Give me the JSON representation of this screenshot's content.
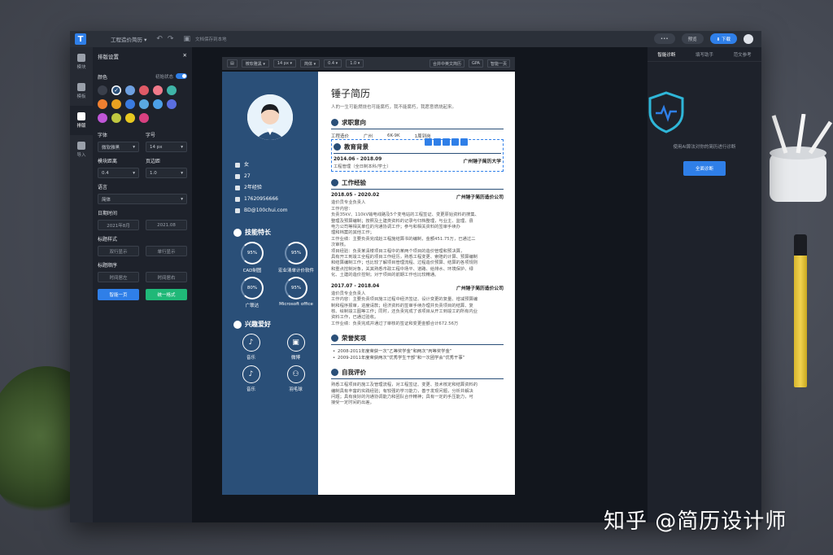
{
  "topbar": {
    "title": "工程造价简历 ▾",
    "save_note": "文档保存到本地",
    "more": "•••",
    "preview": "预览",
    "download": "⬇ 下载"
  },
  "rail": [
    "模块",
    "模板",
    "排版",
    "导入"
  ],
  "settings": {
    "title": "排版设置",
    "color_label": "颜色",
    "initial_state": "初始状态",
    "colors": [
      "#3a3f4b",
      "#2a4f78",
      "#6ea0e0",
      "#e05a66",
      "#f07a8a",
      "#3fb4a8",
      "#f08030",
      "#e8a020",
      "#3a7be0",
      "#5aa8e0",
      "#4ca0e8",
      "#5a6ee0",
      "#c056d8",
      "#c0c840",
      "#e8c820",
      "#d84080"
    ],
    "font_label": "字体",
    "font_value": "微软雅黑",
    "size_label": "字号",
    "size_value": "14 px",
    "module_gap_label": "模块距离",
    "module_gap_value": "0.4",
    "page_margin_label": "页边距",
    "page_margin_value": "1.0",
    "lang_label": "语言",
    "lang_value": "简体",
    "date_label": "日期时间",
    "date_a": "2021年8月",
    "date_b": "2021.08",
    "title_style_label": "标题样式",
    "style_a": "双行显示",
    "style_b": "单行显示",
    "title_order_label": "标题顺序",
    "order_a": "时间居左",
    "order_b": "时间居右",
    "btn_one_page": "智能一页",
    "btn_unify": "统一格式"
  },
  "toolbar2": {
    "font": "微软雅黑 ▾",
    "size": "14 px ▾",
    "lang": "简体 ▾",
    "gap": "0.4 ▾",
    "margin": "1.0 ▾",
    "btn_merge": "合并中英文简历",
    "btn_gpa": "GPA",
    "btn_one_page": "智能一页"
  },
  "resume": {
    "name": "锤子简历",
    "motto": "人的一生可能燃烧也可能腐朽，我不能腐朽，我愿意燃烧起来。",
    "side": {
      "gender": "女",
      "age": "27",
      "years": "2年经验",
      "phone": "17620956666",
      "email": "BD@100chui.com",
      "skills_title": "技能特长",
      "skills": [
        {
          "pct": "95%",
          "name": "CAD制图"
        },
        {
          "pct": "95%",
          "name": "宏业清单计价软件"
        },
        {
          "pct": "80%",
          "name": "广联达"
        },
        {
          "pct": "95%",
          "name": "Microsoft office"
        }
      ],
      "hobby_title": "兴趣爱好",
      "hobbies": [
        {
          "icon": "♪",
          "name": "音乐"
        },
        {
          "icon": "▣",
          "name": "微博"
        },
        {
          "icon": "♪",
          "name": "音乐"
        },
        {
          "icon": "⚇",
          "name": "羽毛球"
        }
      ]
    },
    "intent_title": "求职意向",
    "intent": {
      "role": "工程造价",
      "city": "广州",
      "salary": "6K-9K",
      "status": "1周到岗"
    },
    "edu_title": "教育背景",
    "edu": {
      "period": "2014.06 - 2018.09",
      "school": "广州锤子简历大学",
      "major": "工程管理（全日制本科/学士）"
    },
    "work_title": "工作经验",
    "work": [
      {
        "period": "2018.05 - 2020.02",
        "company": "广州锤子简历造价公司",
        "role": "造价员专业负责人",
        "text": [
          "工作内容：",
          "负责35kV、110kV输电线路及5个变电站的工程签证、变更原始资料的搜集、",
          "整理及预算编制；按照及土建类资料的记录与归档整理，与业主、监理、县",
          "电力公司等相关单位的沟通协调工作；参与和相关资料的签审手续办",
          "理和档案的其他工作；",
          "工作业绩：主要负责完成赵工程施结算书的编制，金额451.75万，已通过二",
          "次审核。",
          "项目经验：负责某清楼项目工程中的某两个项目的造价管理和预决算，",
          "具有开工到竣工全程的项目工作经历，熟悉工程变更、索赔的计算、预算编制",
          "和结算编制工作；也比较了解项目管理流程、过程造价预算、结算的各项规则",
          "和重点控制对象，关其熟悉市政工程中场平、道路、给排水、环境保护、绿",
          "化、土建的造价控制；对于项目的前期工作也比较精通。"
        ]
      },
      {
        "period": "2017.07 - 2018.04",
        "company": "广州锤子简历造价公司",
        "role": "造价员专业负责人",
        "text": [
          "工作内容：主要负责项目施工过程中经济签证、设计变更的复量、增减预算编",
          "制和程序报审，进度请款；经济资料的签审手续办理并负责项目的结算、复",
          "核、绘制竣工图等工作；同时，还负责完成了该项目从开工到竣工的所有内业",
          "资料工作，已通过验收。",
          "工作业绩：负责完成并通过了审核的签证和变更金额合计672.56万"
        ]
      }
    ],
    "honor_title": "荣誉奖项",
    "honors": [
      "2008-2011年度荣获一次“乙等奖学金”和两次“丙等奖学金”",
      "2009-2011年度荣获两次“优秀学生干部”和一次团学会“优秀干事”"
    ],
    "self_title": "自我评价",
    "self": [
      "熟悉工程项目的施工及管理流程，对工程签证、变更、技术核定和结算资料的",
      "编制具有丰富的实践经验；有较强的学习能力，善于发现问题，分析并解决",
      "问题；具有良好的沟通协调能力和团队合作精神；具有一定的手压能力，可",
      "接受一定时间的出差。"
    ]
  },
  "rpanel": {
    "tabs": [
      "智能诊断",
      "填写助手",
      "范文参考"
    ],
    "note": "使用AI算法对你的简历进行诊断",
    "btn": "全面诊断"
  },
  "watermark": "知乎 @简历设计师"
}
